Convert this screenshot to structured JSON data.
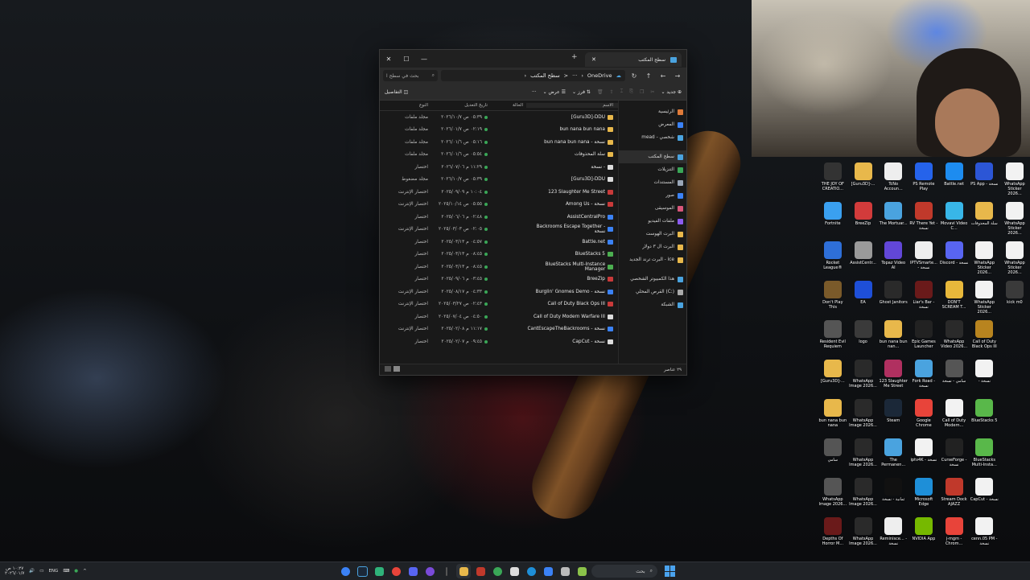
{
  "window": {
    "tab_title": "سطح المكتب",
    "new_tab": "+",
    "controls": {
      "close": "✕",
      "maximize": "☐",
      "minimize": "—"
    },
    "search_placeholder": "بحث في سطح ا",
    "breadcrumb": [
      "OneDrive",
      "سطح المكتب"
    ],
    "breadcrumb_sep": ">",
    "more": "···",
    "toolbar": {
      "new": "جديد",
      "sort": "فرز",
      "view": "عرض",
      "more": "···",
      "details": "التفاصيل"
    },
    "columns": {
      "name": "الاسم",
      "status": "الحالة",
      "date": "تاريخ التعديل",
      "type": "النوع"
    },
    "files": [
      {
        "name": "[Guru3D]-DDU",
        "icon": "folder",
        "date": "٠٥:٣٩ ص ٢٠٢٦/١٠/٧",
        "type": "مجلد ملفات"
      },
      {
        "name": "bun nana bun nana",
        "icon": "folder",
        "date": "٠٢:١٩ ص ٢٠٢٦/٠١/٧",
        "type": "مجلد ملفات"
      },
      {
        "name": "bun nana bun nana - نسخة",
        "icon": "folder",
        "date": "٠٥:١٦ ص ٢٠٢٦/٠١/٦",
        "type": "مجلد ملفات"
      },
      {
        "name": "سلة المحذوفات",
        "icon": "folder",
        "date": "٠٥:٥٤ ص ٢٠٢٦/٠١/٦",
        "type": "مجلد ملفات"
      },
      {
        "name": "نسخة -",
        "icon": "file",
        "date": "١١:٢٩ م ٢٠٢٦/٠٧/٠٦",
        "type": "اختصار"
      },
      {
        "name": "[Guru3D]-DDU",
        "icon": "file",
        "date": "٠٥:٣٩ ص ٢٠٢٦/١٠/٧",
        "type": "مجلد مضغوط"
      },
      {
        "name": "123 Slaughter Me Street",
        "icon": "red",
        "date": "١٠:٠٤ م ٢٠٢٥/٠٩/٠٩",
        "type": "اختصار الإنترنت"
      },
      {
        "name": "Among Us - نسخة",
        "icon": "red",
        "date": "٠٥:٥٥ ص ٢٠٢٥/١٠/١٤",
        "type": "اختصار الإنترنت"
      },
      {
        "name": "AssistCentralPro",
        "icon": "app",
        "date": "٠٢:٤٨ م ٢٠٢٥/٠٦/٠٦",
        "type": "اختصار"
      },
      {
        "name": "Backrooms Escape Together - نسخة",
        "icon": "app",
        "date": "٠٢:٠٥ ص ٢٠٢٥/٠٣/٠٣",
        "type": "اختصار الإنترنت"
      },
      {
        "name": "Battle.net",
        "icon": "app",
        "date": "٠٤:٥٧ م ٢٠٢٥/٠٣/١٣",
        "type": "اختصار"
      },
      {
        "name": "BlueStacks 5",
        "icon": "green",
        "date": "٠٨:٤٥ م ٢٠٢٥/٠٣/١٣",
        "type": "اختصار"
      },
      {
        "name": "BlueStacks Multi-Instance Manager",
        "icon": "green",
        "date": "٠٨:٤٥ م ٢٠٢٥/٠٣/١٣",
        "type": "اختصار"
      },
      {
        "name": "BreeZip",
        "icon": "red",
        "date": "٠٣:٤٥ م ٢٠٢٥/٠٩/٠٦",
        "type": "اختصار"
      },
      {
        "name": "Burglin' Gnomes Demo - نسخة",
        "icon": "app",
        "date": "٠٤:٣٣ م ٢٠٢٥/٠٨/١٧",
        "type": "اختصار الإنترنت"
      },
      {
        "name": "Call of Duty Black Ops III",
        "icon": "red",
        "date": "٠٢:٤٣ ص ٢٠٢٥/٠٣/٢٧",
        "type": "اختصار الإنترنت"
      },
      {
        "name": "Call of Duty Modern Warfare III",
        "icon": "file",
        "date": "٠٤:٥٠ ص ٢٠٢٥/٠٧/٠٤",
        "type": "اختصار"
      },
      {
        "name": "CantEscapeTheBackrooms - نسخة",
        "icon": "app",
        "date": "١١:١٧ م ٢٠٢٥/٠٢/٠٨",
        "type": "اختصار الإنترنت"
      },
      {
        "name": "CapCut - نسخة",
        "icon": "file",
        "date": "٠٩:٤٥ م ٢٠٢٥/٠٢/٠٧",
        "type": "اختصار"
      }
    ],
    "sidebar": [
      {
        "label": "الرئيسية",
        "icon": "home",
        "color": "#e07b39"
      },
      {
        "label": "المعرض",
        "icon": "gallery",
        "color": "#3b82f6"
      },
      {
        "label": "mead - شخصي",
        "icon": "onedrive",
        "color": "#4aa3df"
      },
      {
        "label": "سطح المكتب",
        "icon": "desktop",
        "color": "#4aa3df",
        "active": true
      },
      {
        "label": "التنزيلات",
        "icon": "download",
        "color": "#3aa757"
      },
      {
        "label": "المستندات",
        "icon": "documents",
        "color": "#9aa7b8"
      },
      {
        "label": "صور",
        "icon": "pictures",
        "color": "#3b82f6"
      },
      {
        "label": "الموسيقى",
        "icon": "music",
        "color": "#d8567a"
      },
      {
        "label": "ملفات الفيديو",
        "icon": "video",
        "color": "#8c5cf0"
      },
      {
        "label": "البرت الهوست",
        "icon": "folder",
        "color": "#e8b84b"
      },
      {
        "label": "البرت ال ٣ دولار",
        "icon": "folder",
        "color": "#e8b84b"
      },
      {
        "label": "البرت ترند الجديد - ice",
        "icon": "folder",
        "color": "#e8b84b"
      },
      {
        "label": "هذا الكمبيوتر الشخصي",
        "icon": "pc",
        "color": "#4aa3df"
      },
      {
        "label": "القرص المحلي (C:)",
        "icon": "drive",
        "color": "#aaaaaa"
      },
      {
        "label": "الشبكة",
        "icon": "network",
        "color": "#4aa3df"
      }
    ],
    "status_count": "٢٩ عناصر"
  },
  "desktop_icons": [
    {
      "label": "THE JOY OF CREATIO...",
      "color": "#333333"
    },
    {
      "label": "[Guru3D]-...",
      "color": "#e8b84b"
    },
    {
      "label": "TcNo Accoun...",
      "color": "#eeeeee"
    },
    {
      "label": "PS Remote Play",
      "color": "#2563eb"
    },
    {
      "label": "Battle.net",
      "color": "#1d8cf0"
    },
    {
      "label": "PS App - نسخة",
      "color": "#2c56d6"
    },
    {
      "label": "WhatsApp Sticker 2026...",
      "color": "#f2f2f2"
    },
    {
      "label": "Fortnite",
      "color": "#3aa0f0"
    },
    {
      "label": "BreeZip",
      "color": "#d23b3b"
    },
    {
      "label": "The Mortuar...",
      "color": "#4aa3df"
    },
    {
      "label": "RV There Yet - نسخة",
      "color": "#c0392b"
    },
    {
      "label": "Movavi Video C...",
      "color": "#38b6e8"
    },
    {
      "label": "سلة المحذوفات",
      "color": "#e8b84b"
    },
    {
      "label": "WhatsApp Sticker 2026...",
      "color": "#f2f2f2"
    },
    {
      "label": "Rocket League®",
      "color": "#2e6fd8"
    },
    {
      "label": "AssistCentr...",
      "color": "#9a9a9a"
    },
    {
      "label": "Topaz Video AI",
      "color": "#6247d8"
    },
    {
      "label": "IPTVSmarte... - نسخة",
      "color": "#eeeeee"
    },
    {
      "label": "Discord - نسخة",
      "color": "#5865f2"
    },
    {
      "label": "WhatsApp Sticker 2026...",
      "color": "#f2f2f2"
    },
    {
      "label": "WhatsApp Sticker 2026...",
      "color": "#f2f2f2"
    },
    {
      "label": "Don't Play This",
      "color": "#7a5a2a"
    },
    {
      "label": "EA",
      "color": "#1e4fd8"
    },
    {
      "label": "Ghost Janitors",
      "color": "#2a2a2a"
    },
    {
      "label": "Liar's Bar - نسخة",
      "color": "#6a1a1a"
    },
    {
      "label": "DON'T SCREAM T...",
      "color": "#e8b83b"
    },
    {
      "label": "WhatsApp Sticker 2026...",
      "color": "#f2f2f2"
    },
    {
      "label": "kick m0",
      "color": "#3a3a3a"
    },
    {
      "label": "Resident Evil Requiem",
      "color": "#555555"
    },
    {
      "label": "logo",
      "color": "#3a3a3a"
    },
    {
      "label": "bun nana bun nan...",
      "color": "#e8b84b"
    },
    {
      "label": "Epic Games Launcher",
      "color": "#222222"
    },
    {
      "label": "WhatsApp Video 2026...",
      "color": "#2a2a2a"
    },
    {
      "label": "Call of Duty Black Ops III",
      "color": "#b8841f"
    },
    {
      "label": "",
      "color": "transparent"
    },
    {
      "label": "[Guru3D]-...",
      "color": "#e8b84b"
    },
    {
      "label": "WhatsApp Image 2026...",
      "color": "#2a2a2a"
    },
    {
      "label": "123 Slaughter Me Street",
      "color": "#b03060"
    },
    {
      "label": "Fork Road - نسخة",
      "color": "#4aa3df"
    },
    {
      "label": "سامي - نسخة",
      "color": "#555555"
    },
    {
      "label": "- نسخة",
      "color": "#f2f2f2"
    },
    {
      "label": "",
      "color": "transparent"
    },
    {
      "label": "bun nana bun nana",
      "color": "#e8b84b"
    },
    {
      "label": "WhatsApp Image 2026...",
      "color": "#2a2a2a"
    },
    {
      "label": "Steam",
      "color": "#1b2838"
    },
    {
      "label": "Google Chrome",
      "color": "#e8443a"
    },
    {
      "label": "Call of Duty Modern...",
      "color": "#f2f2f2"
    },
    {
      "label": "BlueStacks 5",
      "color": "#59b84a"
    },
    {
      "label": "",
      "color": "transparent"
    },
    {
      "label": "سامي",
      "color": "#555555"
    },
    {
      "label": "WhatsApp Image 2026...",
      "color": "#2a2a2a"
    },
    {
      "label": "The Permanen...",
      "color": "#4aa3df"
    },
    {
      "label": "iptv4K - نسخة",
      "color": "#f2f2f2"
    },
    {
      "label": "CurseForge - نسخة",
      "color": "#222222"
    },
    {
      "label": "BlueStacks Multi-Insta...",
      "color": "#59b84a"
    },
    {
      "label": "",
      "color": "transparent"
    },
    {
      "label": "WhatsApp Image 2026...",
      "color": "#555555"
    },
    {
      "label": "WhatsApp Image 2026...",
      "color": "#2a2a2a"
    },
    {
      "label": "ثمانية - نسخة",
      "color": "#111111"
    },
    {
      "label": "Microsoft Edge",
      "color": "#1e8fd8"
    },
    {
      "label": "Stream Dock AJAZZ",
      "color": "#c0392b"
    },
    {
      "label": "CapCut - نسخة",
      "color": "#f2f2f2"
    },
    {
      "label": "",
      "color": "transparent"
    },
    {
      "label": "Depths Of Horror M...",
      "color": "#6a1a1a"
    },
    {
      "label": "WhatsApp Image 2026...",
      "color": "#2a2a2a"
    },
    {
      "label": "Reminisce... - نسخة",
      "color": "#eeeeee"
    },
    {
      "label": "NVIDIA App",
      "color": "#76b900"
    },
    {
      "label": "j-mgm - Chrom...",
      "color": "#e8443a"
    },
    {
      "label": "cenn.05 PM - نسخة",
      "color": "#f2f2f2"
    }
  ],
  "taskbar": {
    "time": "١٠:٢٧ ص",
    "date": "٢٠٢٦/٠١/٧",
    "lang": "ENG",
    "chevron": "^",
    "search_label": "بحث"
  }
}
